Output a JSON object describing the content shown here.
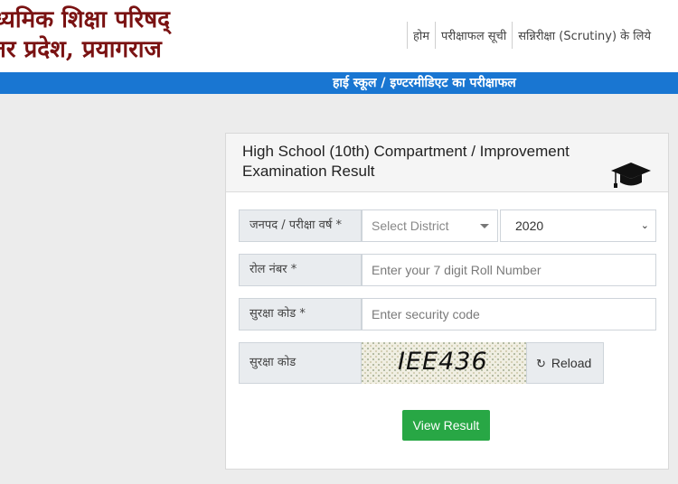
{
  "header": {
    "org_line1": "ध्यमिक शिक्षा परिषद्",
    "org_line2": "तर प्रदेश, प्रयागराज",
    "nav": [
      "होम",
      "परीक्षाफल सूची",
      "सन्निरीक्षा (Scrutiny) के लिये"
    ]
  },
  "banner": {
    "text": "हाई स्कूल / इण्टरमीडिएट का परीक्षाफल"
  },
  "card": {
    "title": "High School (10th) Compartment / Improvement Examination Result",
    "icon": "graduation-cap-icon"
  },
  "form": {
    "district_label": "जनपद / परीक्षा वर्ष *",
    "district_placeholder": "Select District",
    "year_value": "2020",
    "roll_label": "रोल नंबर *",
    "roll_placeholder": "Enter your 7 digit Roll Number",
    "security_label": "सुरक्षा कोड *",
    "security_placeholder": "Enter security code",
    "captcha_label": "सुरक्षा कोड",
    "captcha_text": "IEE436",
    "reload_label": "Reload",
    "submit_label": "View Result"
  },
  "colors": {
    "title_maroon": "#7a1212",
    "banner_blue": "#1976d2",
    "button_green": "#28a745"
  }
}
